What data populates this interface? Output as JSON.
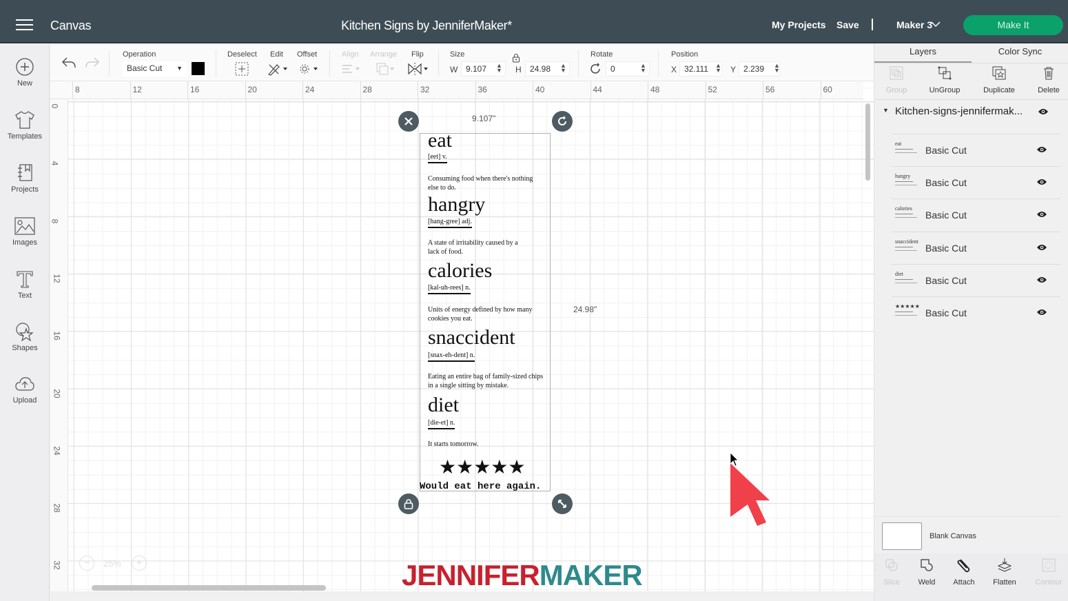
{
  "topbar": {
    "app_name": "Canvas",
    "document_title": "Kitchen Signs by JenniferMaker*",
    "my_projects": "My Projects",
    "save": "Save",
    "machine": "Maker 3",
    "make_it": "Make It"
  },
  "leftbar": {
    "items": [
      {
        "label": "New",
        "icon": "plus-circle-icon"
      },
      {
        "label": "Templates",
        "icon": "tshirt-icon"
      },
      {
        "label": "Projects",
        "icon": "notebook-icon"
      },
      {
        "label": "Images",
        "icon": "image-icon"
      },
      {
        "label": "Text",
        "icon": "text-t-icon"
      },
      {
        "label": "Shapes",
        "icon": "shapes-icon"
      },
      {
        "label": "Upload",
        "icon": "cloud-upload-icon"
      }
    ]
  },
  "toolbar": {
    "operation_label": "Operation",
    "operation_value": "Basic Cut",
    "operation_color": "#000000",
    "deselect": "Deselect",
    "edit": "Edit",
    "offset": "Offset",
    "align": "Align",
    "arrange": "Arrange",
    "flip": "Flip",
    "size_label": "Size",
    "w_label": "W",
    "w_value": "9.107",
    "h_label": "H",
    "h_value": "24.98",
    "rotate_label": "Rotate",
    "rotate_value": "0",
    "position_label": "Position",
    "x_label": "X",
    "x_value": "32.111",
    "y_label": "Y",
    "y_value": "2.239"
  },
  "rulers": {
    "top": [
      "8",
      "12",
      "16",
      "20",
      "24",
      "28",
      "32",
      "36",
      "40",
      "44",
      "48",
      "52",
      "56",
      "60"
    ],
    "left": [
      "0",
      "4",
      "8",
      "12",
      "16",
      "20",
      "24",
      "28",
      "32"
    ]
  },
  "canvas": {
    "width_readout": "9.107\"",
    "height_readout": "24.98\"",
    "zoom": "25%",
    "design": {
      "entries": [
        {
          "word": "eat",
          "pron": "[eet] v.",
          "def": "Consuming food when there's nothing else to do."
        },
        {
          "word": "hangry",
          "pron": "[hang-gree] adj.",
          "def": "A state of irritability caused by a lack of food."
        },
        {
          "word": "calories",
          "pron": "[kal-uh-rees] n.",
          "def": "Units of energy defined by how many cookies you eat."
        },
        {
          "word": "snaccident",
          "pron": "[snax-eh-dent] n.",
          "def": "Eating an entire bag of family-sized chips in a single sitting by mistake."
        },
        {
          "word": "diet",
          "pron": "[die-et] n.",
          "def": "It starts tomorrow."
        }
      ],
      "rating": 5,
      "stars": "★★★★★",
      "tagline": "Would eat here again."
    }
  },
  "right_panel": {
    "tabs": [
      "Layers",
      "Color Sync"
    ],
    "tools": [
      {
        "label": "Group",
        "enabled": false
      },
      {
        "label": "UnGroup",
        "enabled": true
      },
      {
        "label": "Duplicate",
        "enabled": true
      },
      {
        "label": "Delete",
        "enabled": true
      }
    ],
    "group_name": "Kitchen-signs-jennifermak...",
    "layers": [
      {
        "thumb": "eat",
        "name": "Basic Cut"
      },
      {
        "thumb": "hangry",
        "name": "Basic Cut"
      },
      {
        "thumb": "calories",
        "name": "Basic Cut"
      },
      {
        "thumb": "snaccident",
        "name": "Basic Cut"
      },
      {
        "thumb": "diet",
        "name": "Basic Cut"
      },
      {
        "thumb": "★★★★★",
        "name": "Basic Cut"
      }
    ],
    "blank_canvas": "Blank Canvas",
    "bottom_tools": [
      {
        "label": "Slice",
        "enabled": false
      },
      {
        "label": "Weld",
        "enabled": true
      },
      {
        "label": "Attach",
        "enabled": true
      },
      {
        "label": "Flatten",
        "enabled": true
      },
      {
        "label": "Contour",
        "enabled": false
      }
    ]
  },
  "watermark": {
    "part1": "JENNIFER",
    "part2": "MAKER",
    "color1": "#c8202f",
    "color2": "#2e8a8c"
  },
  "colors": {
    "topbar": "#3e4d55",
    "make_it": "#0ba16a",
    "annotation_arrow": "#f0404a"
  }
}
